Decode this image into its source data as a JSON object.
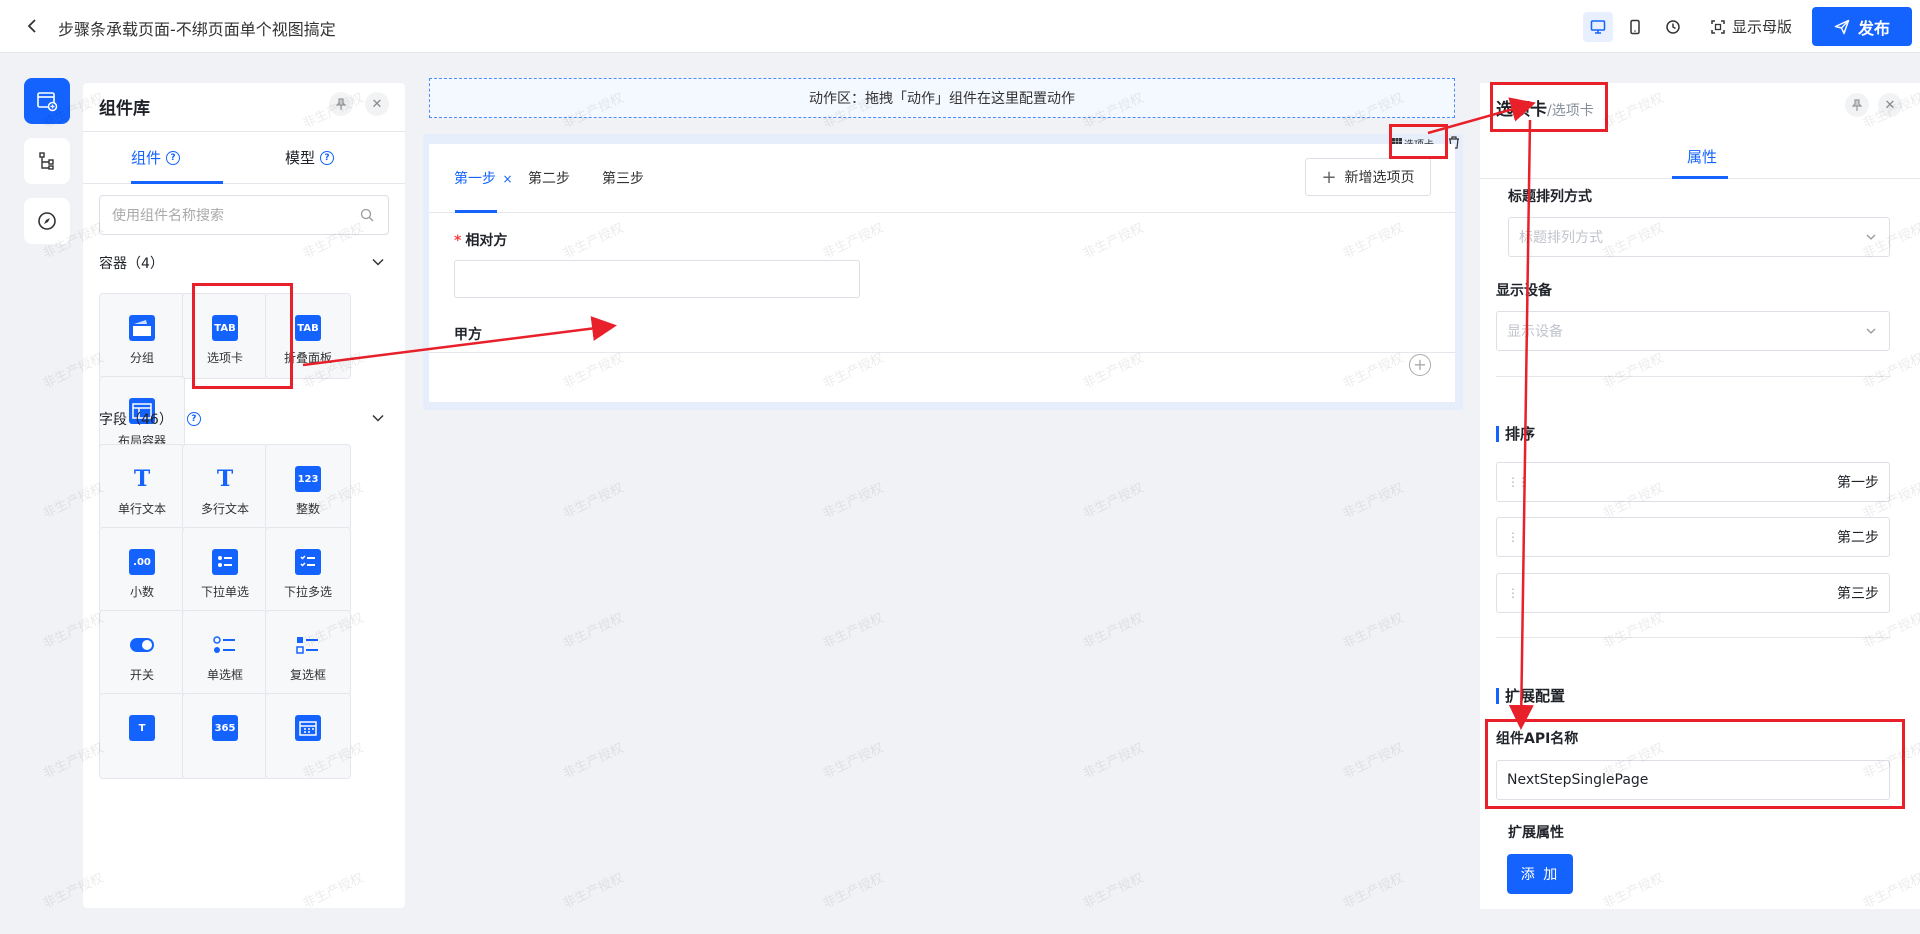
{
  "header": {
    "title": "步骤条承载页面-不绑页面单个视图搞定",
    "show_master": "显示母版",
    "publish": "发布"
  },
  "library": {
    "title": "组件库",
    "tabs": [
      "组件",
      "模型"
    ],
    "search_placeholder": "使用组件名称搜索",
    "containers_title": "容器（4）",
    "containers": [
      "分组",
      "选项卡",
      "折叠面板",
      "布局容器"
    ],
    "fields_title": "字段（46）",
    "fields": [
      "单行文本",
      "多行文本",
      "整数",
      "小数",
      "下拉单选",
      "下拉多选",
      "开关",
      "单选框",
      "复选框"
    ]
  },
  "canvas": {
    "action_zone": "动作区：拖拽「动作」组件在这里配置动作",
    "steps": [
      "第一步",
      "第二步",
      "第三步"
    ],
    "add_tab": "新增选项页",
    "counterparty_label": "相对方",
    "party_a_label": "甲方",
    "component_tag": "选项卡"
  },
  "props": {
    "title": "选项卡",
    "subtitle": "/选项卡",
    "tab": "属性",
    "title_arrange_label": "标题排列方式",
    "title_arrange_placeholder": "标题排列方式",
    "display_device_label": "显示设备",
    "display_device_placeholder": "显示设备",
    "sort_head": "排序",
    "sort_items": [
      "第一步",
      "第二步",
      "第三步"
    ],
    "ext_head": "扩展配置",
    "api_label": "组件API名称",
    "api_value": "NextStepSinglePage",
    "ext_props_label": "扩展属性",
    "add_button": "添 加"
  },
  "watermark": "非生产授权",
  "colors": {
    "primary": "#1463ff",
    "annotation": "#e8202a"
  }
}
